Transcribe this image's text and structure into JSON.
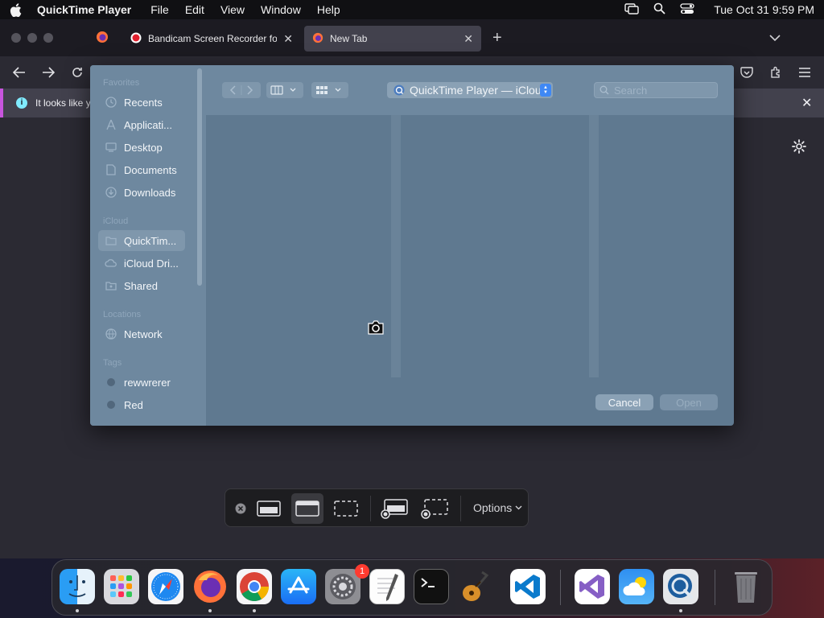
{
  "menubar": {
    "app_name": "QuickTime Player",
    "items": [
      "File",
      "Edit",
      "View",
      "Window",
      "Help"
    ],
    "clock": "Tue Oct 31  9:59 PM"
  },
  "browser": {
    "tabs": [
      {
        "label": "Bandicam Screen Recorder for I",
        "icon": "record-icon"
      },
      {
        "label": "New Tab",
        "icon": "firefox-icon",
        "active": true
      }
    ],
    "infobar_text": "It looks like y"
  },
  "dialog": {
    "sidebar": {
      "favorites_header": "Favorites",
      "favorites": [
        {
          "label": "Recents",
          "icon": "clock-icon"
        },
        {
          "label": "Applicati...",
          "icon": "apps-icon"
        },
        {
          "label": "Desktop",
          "icon": "desktop-icon"
        },
        {
          "label": "Documents",
          "icon": "document-icon"
        },
        {
          "label": "Downloads",
          "icon": "download-icon"
        }
      ],
      "icloud_header": "iCloud",
      "icloud": [
        {
          "label": "QuickTim...",
          "icon": "folder-icon",
          "selected": true
        },
        {
          "label": "iCloud Dri...",
          "icon": "cloud-icon"
        },
        {
          "label": "Shared",
          "icon": "shared-folder-icon"
        }
      ],
      "locations_header": "Locations",
      "locations": [
        {
          "label": "Network",
          "icon": "globe-icon"
        }
      ],
      "tags_header": "Tags",
      "tags": [
        {
          "label": "rewwrerer"
        },
        {
          "label": "Red"
        }
      ]
    },
    "path_label": "QuickTime Player — iCloud",
    "search_placeholder": "Search",
    "cancel_label": "Cancel",
    "open_label": "Open"
  },
  "screenshot_toolbar": {
    "options_label": "Options"
  },
  "dock": {
    "apps": [
      "Finder",
      "Launchpad",
      "Safari",
      "Firefox",
      "Chrome",
      "App Store",
      "System Settings",
      "TextEdit",
      "Terminal",
      "GarageBand",
      "VS Code",
      "Visual Studio",
      "Weather",
      "QuickTime Player",
      "Trash"
    ],
    "settings_badge": "1"
  }
}
